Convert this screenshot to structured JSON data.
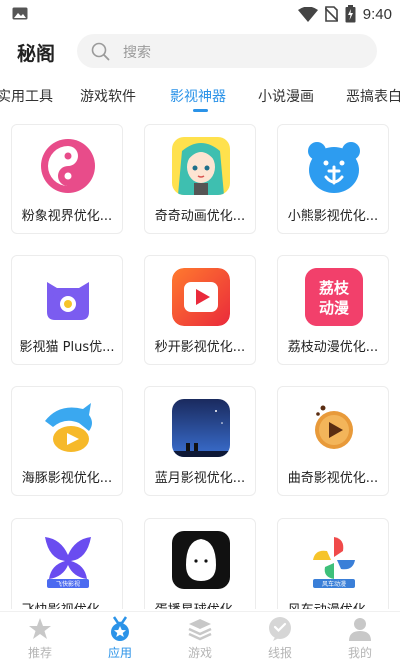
{
  "status_bar": {
    "time": "9:40",
    "icons": [
      "gallery-icon",
      "wifi-icon",
      "no-sim-icon",
      "battery-charging-icon"
    ]
  },
  "header": {
    "title": "秘阁",
    "search_placeholder": "搜索"
  },
  "tabs": [
    {
      "label": "实用工具",
      "active": false
    },
    {
      "label": "游戏软件",
      "active": false
    },
    {
      "label": "影视神器",
      "active": true
    },
    {
      "label": "小说漫画",
      "active": false
    },
    {
      "label": "恶搞表白",
      "active": false
    }
  ],
  "apps": [
    {
      "label": "粉象视界优化...",
      "icon": "pink-yin-yang-icon",
      "color": "#e84c8a"
    },
    {
      "label": "奇奇动画优化...",
      "icon": "anime-girl-icon",
      "color": "#3ebfb0"
    },
    {
      "label": "小熊影视优化...",
      "icon": "bear-anchor-icon",
      "color": "#2d9cf0"
    },
    {
      "label": "影视猫 Plus优...",
      "icon": "purple-cat-icon",
      "color": "#7b5cf0"
    },
    {
      "label": "秒开影视优化...",
      "icon": "play-button-icon",
      "color": "#f0452d"
    },
    {
      "label": "荔枝动漫优化...",
      "icon": "litchi-text-icon",
      "color": "#f2406b",
      "icon_text": [
        "荔枝",
        "动漫"
      ]
    },
    {
      "label": "海豚影视优化...",
      "icon": "dolphin-icon",
      "color": "#3aa8f0"
    },
    {
      "label": "蓝月影视优化...",
      "icon": "blue-moon-icon",
      "color": "#1f3f8a"
    },
    {
      "label": "曲奇影视优化...",
      "icon": "cookie-play-icon",
      "color": "#e89a3a"
    },
    {
      "label": "飞快影视优化...",
      "icon": "butterfly-icon",
      "color": "#6a4cf0",
      "icon_text": [
        "飞快影视"
      ]
    },
    {
      "label": "蛋播星球优化...",
      "icon": "egg-tv-icon",
      "color": "#111111"
    },
    {
      "label": "风车动漫优化...",
      "icon": "pinwheel-icon",
      "color": "#3a7fd8",
      "icon_text": [
        "风车动漫"
      ]
    }
  ],
  "bottom_nav": [
    {
      "label": "推荐",
      "icon": "star-icon",
      "active": false
    },
    {
      "label": "应用",
      "icon": "medal-star-icon",
      "active": true
    },
    {
      "label": "游戏",
      "icon": "layers-icon",
      "active": false
    },
    {
      "label": "线报",
      "icon": "chat-dots-icon",
      "active": false
    },
    {
      "label": "我的",
      "icon": "person-icon",
      "active": false
    }
  ],
  "colors": {
    "accent": "#2b93e8",
    "inactive": "#b5b5b5"
  }
}
